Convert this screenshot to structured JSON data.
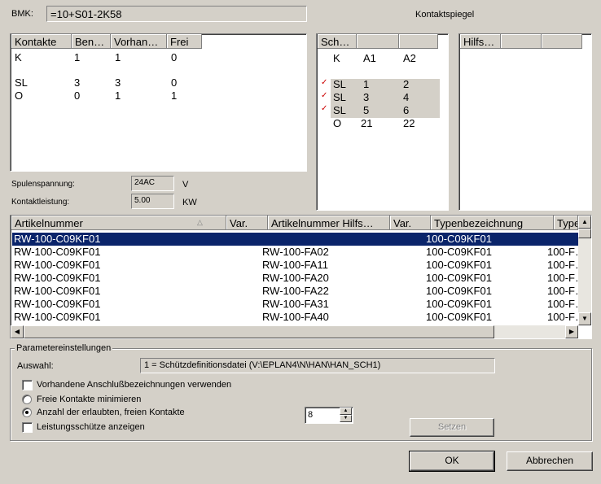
{
  "bmk": {
    "label": "BMK:",
    "value": "=10+S01-2K58"
  },
  "kontaktspiegel_title": "Kontaktspiegel",
  "contacts_table": {
    "headers": [
      "Kontakte",
      "Ben…",
      "Vorhan…",
      "Frei"
    ],
    "rows": [
      [
        "K",
        "1",
        "1",
        "0"
      ],
      [
        "SL",
        "3",
        "3",
        "0"
      ],
      [
        "O",
        "0",
        "1",
        "1"
      ]
    ]
  },
  "spiegel_table": {
    "headers": [
      "Sch…",
      "",
      ""
    ],
    "rows": [
      {
        "check": "",
        "c1": "K",
        "c2": "A1",
        "c3": "A2"
      },
      {
        "check": "✓",
        "c1": "SL",
        "c2": "1",
        "c3": "2"
      },
      {
        "check": "✓",
        "c1": "SL",
        "c2": "3",
        "c3": "4"
      },
      {
        "check": "✓",
        "c1": "SL",
        "c2": "5",
        "c3": "6"
      },
      {
        "check": "",
        "c1": "O",
        "c2": "21",
        "c3": "22"
      }
    ]
  },
  "hilfs_table": {
    "headers": [
      "Hilfs…",
      "",
      ""
    ]
  },
  "spulenspannung": {
    "label": "Spulenspannung:",
    "value": "24AC",
    "unit": "V"
  },
  "kontaktleistung": {
    "label": "Kontaktleistung:",
    "value": "5.00",
    "unit": "KW"
  },
  "article_table": {
    "headers": [
      "Artikelnummer",
      "Var.",
      "Artikelnummer Hilfs…",
      "Var.",
      "Typenbezeichnung",
      "Typen"
    ],
    "rows": [
      [
        "RW-100-C09KF01",
        "",
        "",
        "",
        "100-C09KF01",
        ""
      ],
      [
        "RW-100-C09KF01",
        "",
        "RW-100-FA02",
        "",
        "100-C09KF01",
        "100-F…"
      ],
      [
        "RW-100-C09KF01",
        "",
        "RW-100-FA11",
        "",
        "100-C09KF01",
        "100-F…"
      ],
      [
        "RW-100-C09KF01",
        "",
        "RW-100-FA20",
        "",
        "100-C09KF01",
        "100-F…"
      ],
      [
        "RW-100-C09KF01",
        "",
        "RW-100-FA22",
        "",
        "100-C09KF01",
        "100-F…"
      ],
      [
        "RW-100-C09KF01",
        "",
        "RW-100-FA31",
        "",
        "100-C09KF01",
        "100-F…"
      ],
      [
        "RW-100-C09KF01",
        "",
        "RW-100-FA40",
        "",
        "100-C09KF01",
        "100-F…"
      ]
    ],
    "selected_row": 0
  },
  "params": {
    "group_title": "Parametereinstellungen",
    "auswahl_label": "Auswahl:",
    "auswahl_value": "1 = Schützdefinitionsdatei (V:\\EPLAN4\\N\\HAN\\HAN_SCH1)",
    "chk_anschluss": "Vorhandene Anschlußbezeichnungen verwenden",
    "radio_minimieren": "Freie Kontakte minimieren",
    "radio_anzahl": "Anzahl der erlaubten, freien Kontakte",
    "anzahl_value": "8",
    "chk_leistung": "Leistungsschütze anzeigen",
    "setzen_label": "Setzen"
  },
  "buttons": {
    "ok": "OK",
    "cancel": "Abbrechen"
  }
}
